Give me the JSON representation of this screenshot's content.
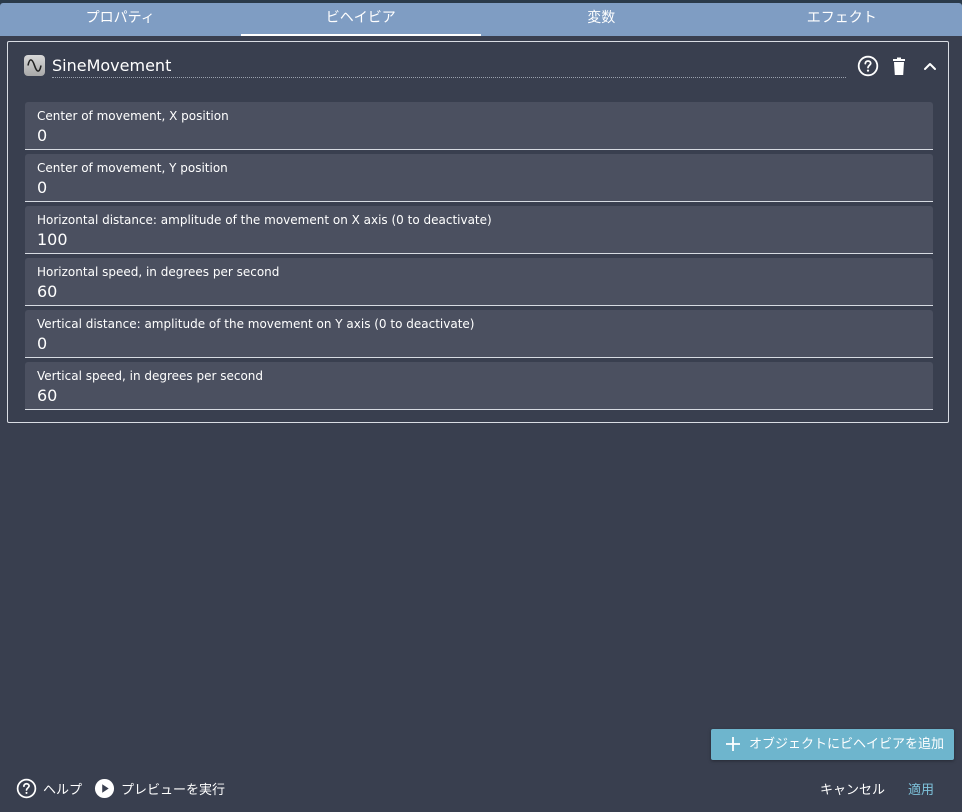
{
  "tabs": [
    {
      "label": "プロパティ",
      "active": false
    },
    {
      "label": "ビヘイビア",
      "active": true
    },
    {
      "label": "変数",
      "active": false
    },
    {
      "label": "エフェクト",
      "active": false
    }
  ],
  "behavior": {
    "icon": "sine-wave-icon",
    "name": "SineMovement",
    "parameters": [
      {
        "label": "Center of movement, X position",
        "value": "0"
      },
      {
        "label": "Center of movement, Y position",
        "value": "0"
      },
      {
        "label": "Horizontal distance: amplitude of the movement on X axis (0 to deactivate)",
        "value": "100"
      },
      {
        "label": "Horizontal speed, in degrees per second",
        "value": "60"
      },
      {
        "label": "Vertical distance: amplitude of the movement on Y axis (0 to deactivate)",
        "value": "0"
      },
      {
        "label": "Vertical speed, in degrees per second",
        "value": "60"
      }
    ]
  },
  "actions": {
    "add_behavior": "オブジェクトにビヘイビアを追加",
    "help": "ヘルプ",
    "run_preview": "プレビューを実行",
    "cancel": "キャンセル",
    "apply": "適用"
  },
  "colors": {
    "background": "#393f4f",
    "tab_bar": "#7f9dc3",
    "field_background": "#4b5060",
    "accent": "#6eb5cd"
  }
}
